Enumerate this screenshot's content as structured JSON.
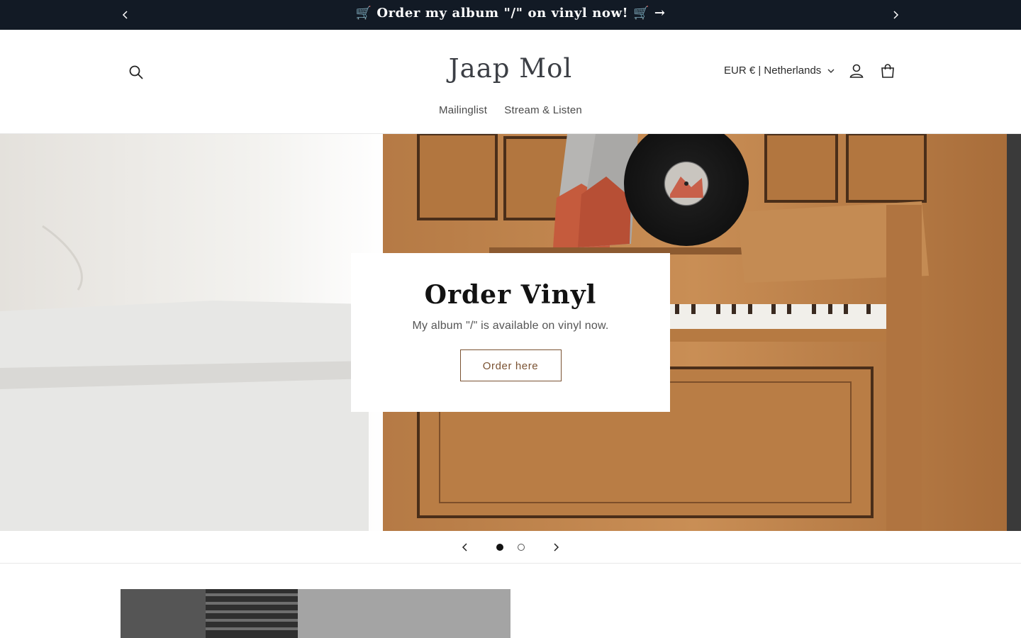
{
  "announcement": {
    "message": "🛒 Order my album \"/\" on vinyl now! 🛒 →"
  },
  "header": {
    "logo": "Jaap Mol",
    "locale": "EUR € | Netherlands",
    "nav": [
      "Mailinglist",
      "Stream & Listen"
    ]
  },
  "hero": {
    "heading": "Order Vinyl",
    "text": "My album \"/\" is available on vinyl now.",
    "button": "Order here"
  },
  "slider": {
    "slides": 2,
    "current": 1
  },
  "colors": {
    "announcement_bg": "#121a25",
    "button_accent": "#7a5232",
    "text": "#121212"
  },
  "icons": [
    "chevron-left-icon",
    "chevron-right-icon",
    "search-icon",
    "chevron-down-icon",
    "account-icon",
    "cart-icon"
  ]
}
